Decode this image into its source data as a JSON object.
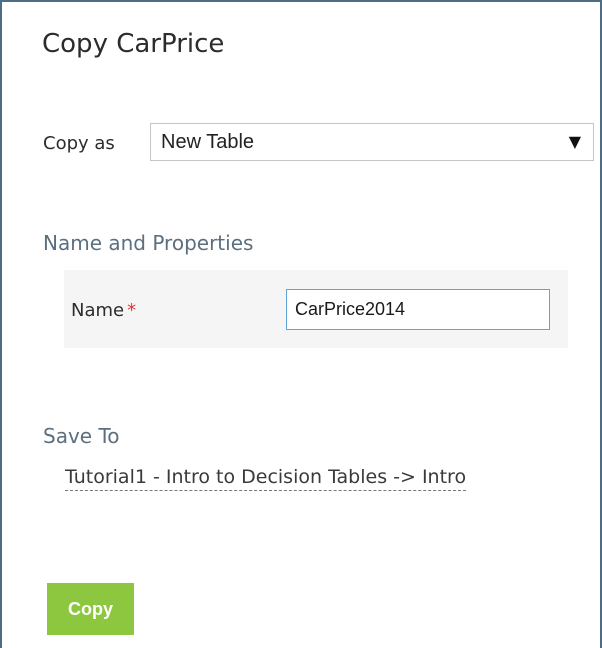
{
  "dialog": {
    "title": "Copy CarPrice"
  },
  "copy_as": {
    "label": "Copy as",
    "selected": "New Table",
    "arrow_icon": "dropdown-triangle-icon"
  },
  "properties": {
    "heading": "Name and Properties",
    "name_label": "Name",
    "required_marker": "*",
    "name_value": "CarPrice2014"
  },
  "save_to": {
    "heading": "Save To",
    "path": "Tutorial1 - Intro to Decision Tables -> Intro"
  },
  "actions": {
    "copy_label": "Copy"
  },
  "colors": {
    "primary_button": "#8dc63f",
    "section_heading": "#5c6f7f",
    "required": "#e03232",
    "input_focus_border": "#5fa6d6"
  }
}
